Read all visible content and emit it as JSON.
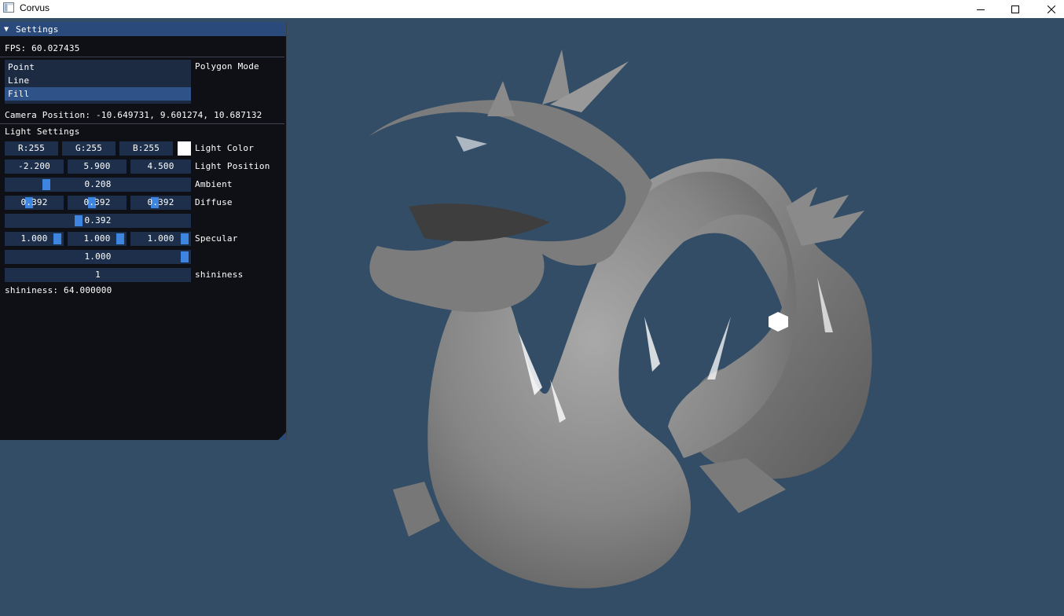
{
  "window": {
    "title": "Corvus",
    "minimize_icon": "minimize-icon",
    "maximize_icon": "maximize-icon",
    "close_icon": "close-icon"
  },
  "viewport": {
    "background_color": "#334d66",
    "model": "dragon mesh"
  },
  "settings_panel": {
    "header": "Settings",
    "fps": "FPS: 60.027435",
    "polygon_mode": {
      "label": "Polygon Mode",
      "options": [
        "Point",
        "Line",
        "Fill"
      ],
      "selected": "Fill"
    },
    "camera_position": "Camera Position: -10.649731, 9.601274, 10.687132",
    "light_settings_heading": "Light Settings",
    "light_color": {
      "r": "R:255",
      "g": "G:255",
      "b": "B:255",
      "swatch_color": "#ffffff",
      "label": "Light Color"
    },
    "light_position": {
      "x": "-2.200",
      "y": "5.900",
      "z": "4.500",
      "label": "Light Position"
    },
    "ambient": {
      "value": "0.208",
      "label": "Ambient"
    },
    "diffuse": {
      "x": "0.392",
      "y": "0.392",
      "z": "0.392",
      "all": "0.392",
      "label": "Diffuse"
    },
    "specular": {
      "x": "1.000",
      "y": "1.000",
      "z": "1.000",
      "all": "1.000",
      "label": "Specular"
    },
    "shininess_slider": {
      "value": "1",
      "label": "shininess"
    },
    "shininess_readout": "shininess: 64.000000",
    "accent_color": "#3d85e0",
    "header_color": "#294a7a"
  }
}
